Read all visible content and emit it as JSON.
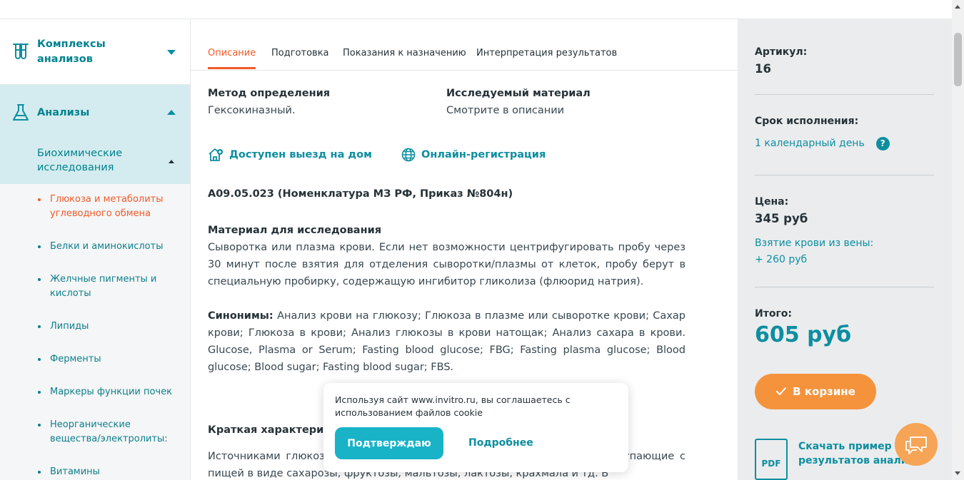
{
  "sidebar": {
    "complexes_label": "Комплексы анализов",
    "analyses_label": "Анализы",
    "biochem_label": "Биохимические исследования",
    "items": [
      {
        "label": "Глюкоза и метаболиты углеводного обмена",
        "active": true
      },
      {
        "label": "Белки и аминокислоты",
        "active": false
      },
      {
        "label": "Желчные пигменты и кислоты",
        "active": false
      },
      {
        "label": "Липиды",
        "active": false
      },
      {
        "label": "Ферменты",
        "active": false
      },
      {
        "label": "Маркеры функции почек",
        "active": false
      },
      {
        "label": "Неорганические вещества/электролиты:",
        "active": false
      },
      {
        "label": "Витамины",
        "active": false
      }
    ]
  },
  "tabs": [
    {
      "label": "Описание",
      "active": true
    },
    {
      "label": "Подготовка",
      "active": false
    },
    {
      "label": "Показания к назначению",
      "active": false
    },
    {
      "label": "Интерпретация результатов",
      "active": false
    }
  ],
  "content": {
    "method_label": "Метод определения",
    "method_value": "Гексокиназный.",
    "material_label": "Исследуемый материал",
    "material_value": "Смотрите в описании",
    "home_visit": "Доступен выезд на дом",
    "online_reg": "Онлайн-регистрация",
    "code": "A09.05.023 (Номенклатура МЗ РФ, Приказ №804н)",
    "study_material_title": "Материал для исследования",
    "study_material_text": "Сыворотка или плазма крови. Если нет возможности центрифугировать пробу через 30 минут после взятия для отделения сыворотки/плазмы от клеток, пробу берут в специальную пробирку, содержащую ингибитор гликолиза (флюорид натрия).",
    "synonyms_label": "Синонимы:",
    "synonyms_text": " Анализ крови на глюкозу; Глюкоза в плазме или сыворотке крови; Сахар крови; Глюкоза в крови; Анализ глюкозы в крови натощак; Анализ сахара в крови. Glucose, Plasma or Serum; Fasting blood glucose; FBG; Fasting plasma glucose; Blood glucose; Blood sugar; Fasting blood sugar; FBS.",
    "brief_title": "Краткая характеристика определяемого вещества",
    "brief_text": "Источниками глюкозы являются углеводы (быстрые и медленные), поступающие с пищей в виде сахарозы, фруктозы, мальтозы, лактозы, крахмала и тд. В"
  },
  "right": {
    "article_label": "Артикул:",
    "article_value": "16",
    "term_label": "Срок исполнения:",
    "term_value": "1 календарный день",
    "help_glyph": "?",
    "price_label": "Цена:",
    "price_value": "345 руб",
    "blood_label": "Взятие крови из вены:",
    "blood_value": "+ 260 руб",
    "total_label": "Итого:",
    "total_value": "605 руб",
    "cart_label": "В корзине",
    "pdf_label": "PDF",
    "pdf_link": "Скачать пример результатов анализа"
  },
  "cookie": {
    "text": "Используя сайт www.invitro.ru, вы соглашаетесь с использованием файлов cookie",
    "confirm": "Подтверждаю",
    "more": "Подробнее"
  },
  "colors": {
    "accent": "#0d8ea0",
    "active_orange": "#f05a28",
    "cart_orange": "#f5933c",
    "cookie_button": "#19b3c8"
  }
}
